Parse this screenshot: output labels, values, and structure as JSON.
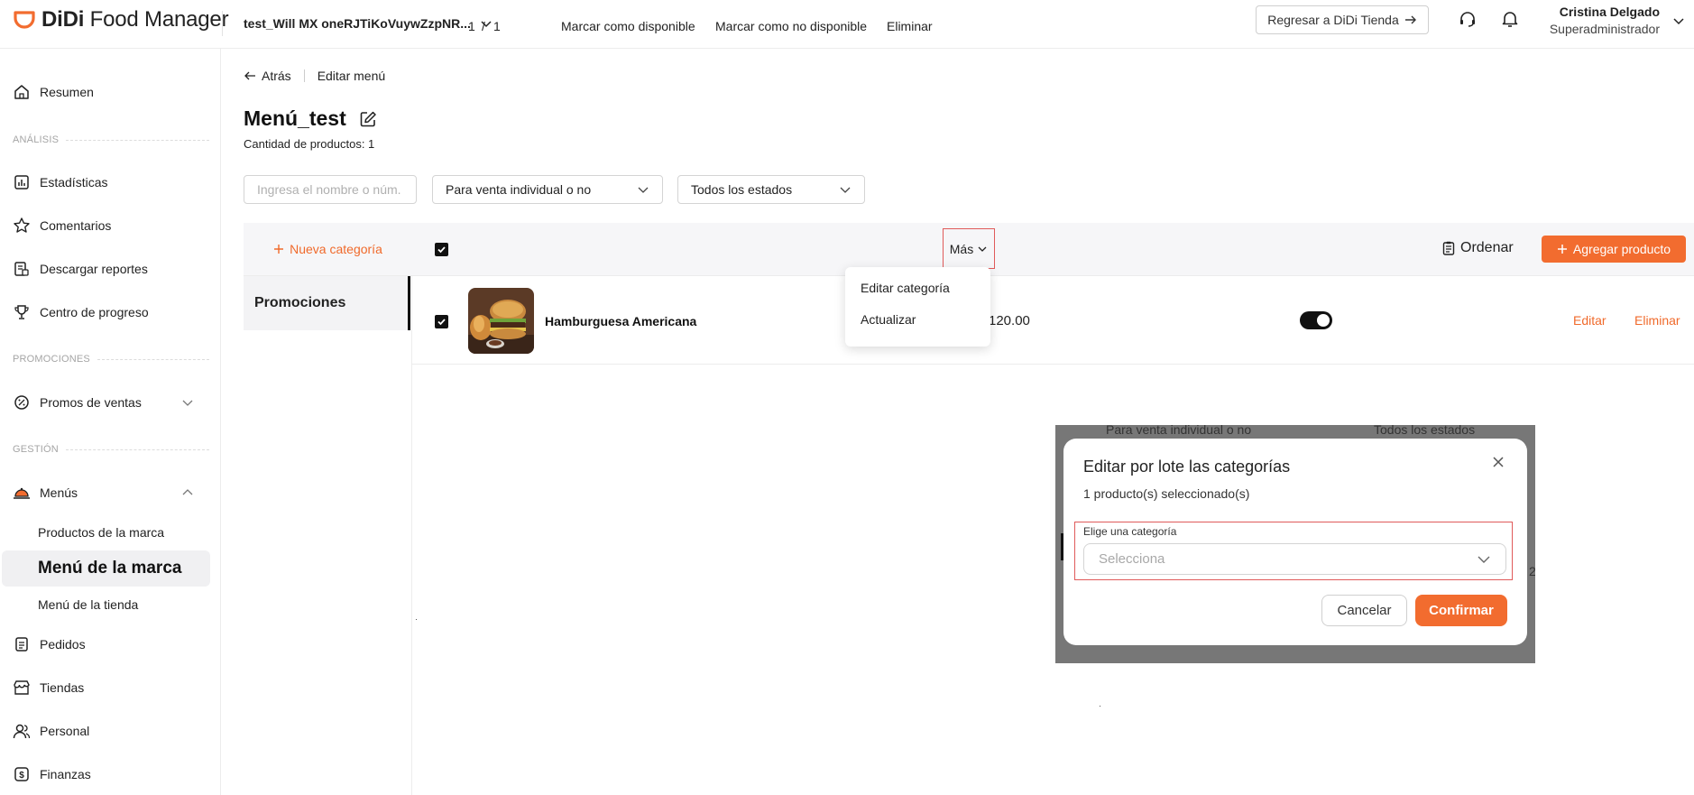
{
  "brand": {
    "name_bold": "DiDi",
    "name_rest": " Food Manager",
    "accent": "#f26c2f"
  },
  "header": {
    "store": "test_Will MX oneRJTiKoVuywZzpNR...",
    "back_to_store": "Regresar a DiDi Tienda",
    "user_name": "Cristina Delgado",
    "user_role": "Superadministrador"
  },
  "sidebar": {
    "resumen": "Resumen",
    "section_analisis": "ANÁLISIS",
    "estadisticas": "Estadísticas",
    "comentarios": "Comentarios",
    "reportes": "Descargar reportes",
    "progreso": "Centro de progreso",
    "section_promociones": "PROMOCIONES",
    "promos": "Promos de ventas",
    "section_gestion": "GESTIÓN",
    "menus": "Menús",
    "productos_marca": "Productos de la marca",
    "menu_marca": "Menú de la marca",
    "menu_tienda": "Menú de la tienda",
    "pedidos": "Pedidos",
    "tiendas": "Tiendas",
    "personal": "Personal",
    "finanzas": "Finanzas"
  },
  "breadcrumb": {
    "back": "Atrás",
    "current": "Editar menú"
  },
  "page": {
    "title": "Menú_test",
    "product_count": "Cantidad de productos: 1"
  },
  "filters": {
    "search_placeholder": "Ingresa el nombre o núm. d",
    "sale_type": "Para venta individual o no",
    "status": "Todos los estados"
  },
  "categories": {
    "new_category": "Nueva categoría",
    "active": "Promociones"
  },
  "toolbar": {
    "selected": "1",
    "slash": "/",
    "total": "1",
    "mark_available": "Marcar como disponible",
    "mark_unavailable": "Marcar como no disponible",
    "delete": "Eliminar",
    "more": "Más",
    "sort": "Ordenar",
    "add_product": "Agregar producto"
  },
  "products": [
    {
      "name": "Hamburguesa Americana",
      "price": "120.00",
      "available": true,
      "edit": "Editar",
      "delete": "Eliminar"
    }
  ],
  "more_menu": {
    "items": [
      "Editar categoría",
      "Actualizar"
    ]
  },
  "dialog_backdrop": {
    "sale_type": "Para venta individual o no",
    "status": "Todos los estados",
    "clipped_digit": "2"
  },
  "dialog": {
    "title": "Editar por lote las categorías",
    "subtitle": "1 producto(s) seleccionado(s)",
    "field_label": "Elige una categoría",
    "select_placeholder": "Selecciona",
    "cancel": "Cancelar",
    "confirm": "Confirmar"
  }
}
